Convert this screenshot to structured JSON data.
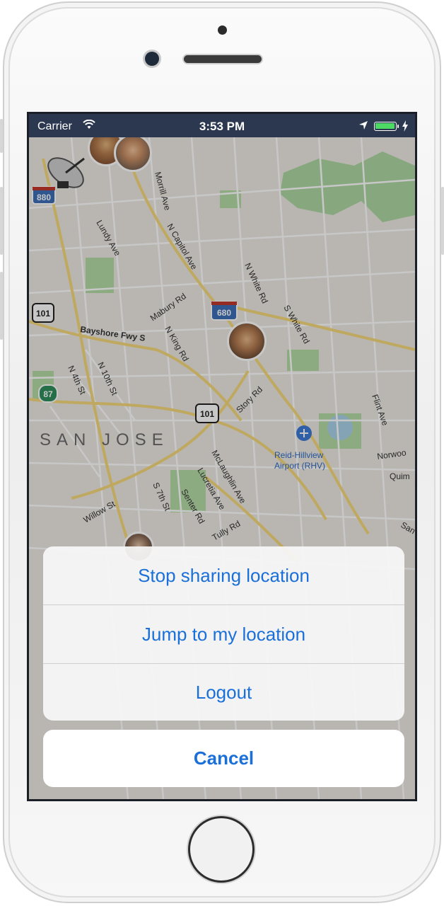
{
  "status_bar": {
    "carrier": "Carrier",
    "time": "3:53 PM",
    "battery_color": "#4cd964"
  },
  "map": {
    "city_label": "SAN JOSE",
    "airport_label_line1": "Reid-Hillview",
    "airport_label_line2": "Airport (RHV)",
    "street_labels": {
      "morrill": "Morrill Ave",
      "capitol": "N Capitol Ave",
      "lundy": "Lundy Ave",
      "white": "N White Rd",
      "mabury": "Mabury Rd",
      "king": "N King Rd",
      "s_white": "S White Rd",
      "bayshore": "Bayshore Fwy S",
      "n4th": "N 4th St",
      "n10th": "N 10th St",
      "story": "Story Rd",
      "flint": "Flint Ave",
      "norwood": "Norwoo",
      "quim": "Quim",
      "mclaughlin": "McLaughlin Ave",
      "lucretia": "Lucretia Ave",
      "senter": "Senter Rd",
      "s7th": "S 7th St",
      "willow": "Willow St",
      "tully": "Tully Rd",
      "san": "San"
    },
    "shields": {
      "i880": "880",
      "us101_a": "101",
      "i680": "680",
      "sr87": "87",
      "us101_b": "101"
    }
  },
  "action_sheet": {
    "options": [
      {
        "label": "Stop sharing location"
      },
      {
        "label": "Jump to my location"
      },
      {
        "label": "Logout"
      }
    ],
    "cancel_label": "Cancel",
    "accent_color": "#1a6fd9"
  }
}
